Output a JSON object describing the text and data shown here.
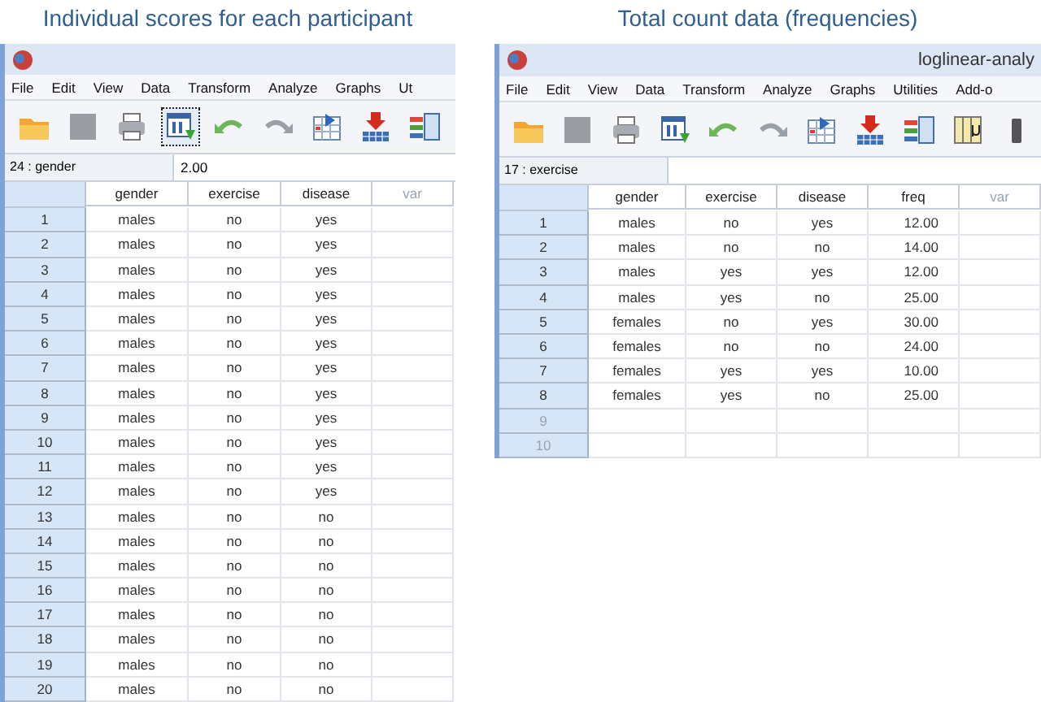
{
  "panels": [
    {
      "heading": "Individual scores for each participant",
      "window": {
        "menu": [
          "File",
          "Edit",
          "View",
          "Data",
          "Transform",
          "Analyze",
          "Graphs",
          "Ut"
        ],
        "toolbar": [
          {
            "kind": "folder",
            "selected": false
          },
          {
            "kind": "save",
            "selected": false
          },
          {
            "kind": "print",
            "selected": false
          },
          {
            "kind": "dialog",
            "selected": true
          },
          {
            "kind": "undo",
            "selected": false
          },
          {
            "kind": "redo",
            "selected": false
          },
          {
            "kind": "goto",
            "selected": false
          },
          {
            "kind": "insert",
            "selected": false
          },
          {
            "kind": "columns",
            "selected": false
          }
        ],
        "cell_ref": "24 : gender",
        "cell_value": "2.00",
        "columns": [
          {
            "label": "gender",
            "dimmed": false
          },
          {
            "label": "exercise",
            "dimmed": false
          },
          {
            "label": "disease",
            "dimmed": false
          },
          {
            "label": "var",
            "dimmed": true
          }
        ],
        "rows": [
          {
            "number": "1",
            "dimmed": false,
            "cells": [
              "males",
              "no",
              "yes"
            ]
          },
          {
            "number": "2",
            "dimmed": false,
            "cells": [
              "males",
              "no",
              "yes"
            ]
          },
          {
            "number": "3",
            "dimmed": false,
            "cells": [
              "males",
              "no",
              "yes"
            ]
          },
          {
            "number": "4",
            "dimmed": false,
            "cells": [
              "males",
              "no",
              "yes"
            ]
          },
          {
            "number": "5",
            "dimmed": false,
            "cells": [
              "males",
              "no",
              "yes"
            ]
          },
          {
            "number": "6",
            "dimmed": false,
            "cells": [
              "males",
              "no",
              "yes"
            ]
          },
          {
            "number": "7",
            "dimmed": false,
            "cells": [
              "males",
              "no",
              "yes"
            ]
          },
          {
            "number": "8",
            "dimmed": false,
            "cells": [
              "males",
              "no",
              "yes"
            ]
          },
          {
            "number": "9",
            "dimmed": false,
            "cells": [
              "males",
              "no",
              "yes"
            ]
          },
          {
            "number": "10",
            "dimmed": false,
            "cells": [
              "males",
              "no",
              "yes"
            ]
          },
          {
            "number": "11",
            "dimmed": false,
            "cells": [
              "males",
              "no",
              "yes"
            ]
          },
          {
            "number": "12",
            "dimmed": false,
            "cells": [
              "males",
              "no",
              "yes"
            ]
          },
          {
            "number": "13",
            "dimmed": false,
            "cells": [
              "males",
              "no",
              "no"
            ]
          },
          {
            "number": "14",
            "dimmed": false,
            "cells": [
              "males",
              "no",
              "no"
            ]
          },
          {
            "number": "15",
            "dimmed": false,
            "cells": [
              "males",
              "no",
              "no"
            ]
          },
          {
            "number": "16",
            "dimmed": false,
            "cells": [
              "males",
              "no",
              "no"
            ]
          },
          {
            "number": "17",
            "dimmed": false,
            "cells": [
              "males",
              "no",
              "no"
            ]
          },
          {
            "number": "18",
            "dimmed": false,
            "cells": [
              "males",
              "no",
              "no"
            ]
          },
          {
            "number": "19",
            "dimmed": false,
            "cells": [
              "males",
              "no",
              "no"
            ]
          },
          {
            "number": "20",
            "dimmed": false,
            "cells": [
              "males",
              "no",
              "no"
            ]
          }
        ]
      }
    },
    {
      "heading": "Total count data (frequencies)",
      "window": {
        "title": "loglinear-analy",
        "menu": [
          "File",
          "Edit",
          "View",
          "Data",
          "Transform",
          "Analyze",
          "Graphs",
          "Utilities",
          "Add-o"
        ],
        "toolbar": [
          {
            "kind": "folder",
            "selected": false
          },
          {
            "kind": "save",
            "selected": false
          },
          {
            "kind": "print",
            "selected": false
          },
          {
            "kind": "dialog",
            "selected": false
          },
          {
            "kind": "undo",
            "selected": false
          },
          {
            "kind": "redo",
            "selected": false
          },
          {
            "kind": "goto",
            "selected": false
          },
          {
            "kind": "insert",
            "selected": false
          },
          {
            "kind": "columns",
            "selected": false
          },
          {
            "kind": "labels",
            "selected": false
          },
          {
            "kind": "scale",
            "selected": false
          }
        ],
        "cell_ref": "17 : exercise",
        "columns": [
          {
            "label": "gender",
            "dimmed": false
          },
          {
            "label": "exercise",
            "dimmed": false
          },
          {
            "label": "disease",
            "dimmed": false
          },
          {
            "label": "freq",
            "dimmed": false
          },
          {
            "label": "var",
            "dimmed": true
          }
        ],
        "rows": [
          {
            "number": "1",
            "dimmed": false,
            "cells": [
              "males",
              "no",
              "yes",
              "12.00"
            ]
          },
          {
            "number": "2",
            "dimmed": false,
            "cells": [
              "males",
              "no",
              "no",
              "14.00"
            ]
          },
          {
            "number": "3",
            "dimmed": false,
            "cells": [
              "males",
              "yes",
              "yes",
              "12.00"
            ]
          },
          {
            "number": "4",
            "dimmed": false,
            "cells": [
              "males",
              "yes",
              "no",
              "25.00"
            ]
          },
          {
            "number": "5",
            "dimmed": false,
            "cells": [
              "females",
              "no",
              "yes",
              "30.00"
            ]
          },
          {
            "number": "6",
            "dimmed": false,
            "cells": [
              "females",
              "no",
              "no",
              "24.00"
            ]
          },
          {
            "number": "7",
            "dimmed": false,
            "cells": [
              "females",
              "yes",
              "yes",
              "10.00"
            ]
          },
          {
            "number": "8",
            "dimmed": false,
            "cells": [
              "females",
              "yes",
              "no",
              "25.00"
            ]
          },
          {
            "number": "9",
            "dimmed": true,
            "cells": []
          },
          {
            "number": "10",
            "dimmed": true,
            "cells": []
          }
        ]
      }
    }
  ]
}
